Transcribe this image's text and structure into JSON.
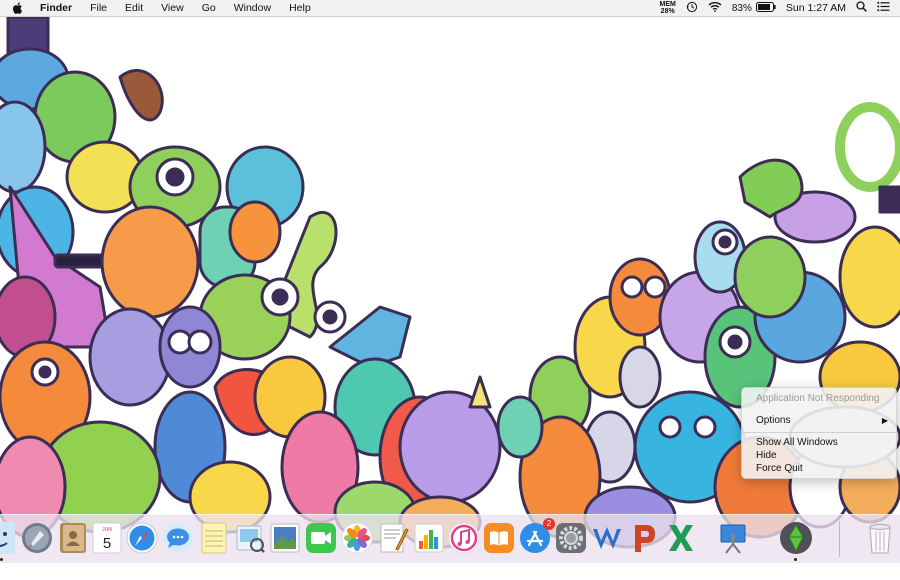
{
  "menubar": {
    "app_name": "Finder",
    "menus": [
      "File",
      "Edit",
      "View",
      "Go",
      "Window",
      "Help"
    ],
    "status": {
      "mem_label": "MEM",
      "mem_value": "28%",
      "battery_percent": "83%",
      "clock": "Sun 1:27 AM"
    },
    "icons": [
      "apple-icon",
      "time-machine-icon",
      "wifi-icon",
      "battery-icon",
      "spotlight-icon",
      "notification-center-icon"
    ]
  },
  "context_menu": {
    "status_text": "Application Not Responding",
    "items": [
      "Options",
      "Show All Windows",
      "Hide",
      "Force Quit"
    ]
  },
  "dock": {
    "calendar": {
      "month": "JUN",
      "day": "5"
    },
    "app_store_badge": "2",
    "apps": [
      "finder",
      "launchpad",
      "contacts",
      "calendar",
      "safari",
      "messages",
      "notes",
      "preview",
      "photo-viewer",
      "facetime",
      "photos",
      "textedit",
      "numbers",
      "itunes",
      "ibooks",
      "app-store",
      "system-preferences",
      "word",
      "powerpoint",
      "excel",
      "keynote",
      "sims",
      "trash"
    ]
  },
  "colors": {
    "menubar_bg": "#f0f0f0",
    "badge": "#e3352c",
    "menu_disabled": "#9a9a9a"
  }
}
